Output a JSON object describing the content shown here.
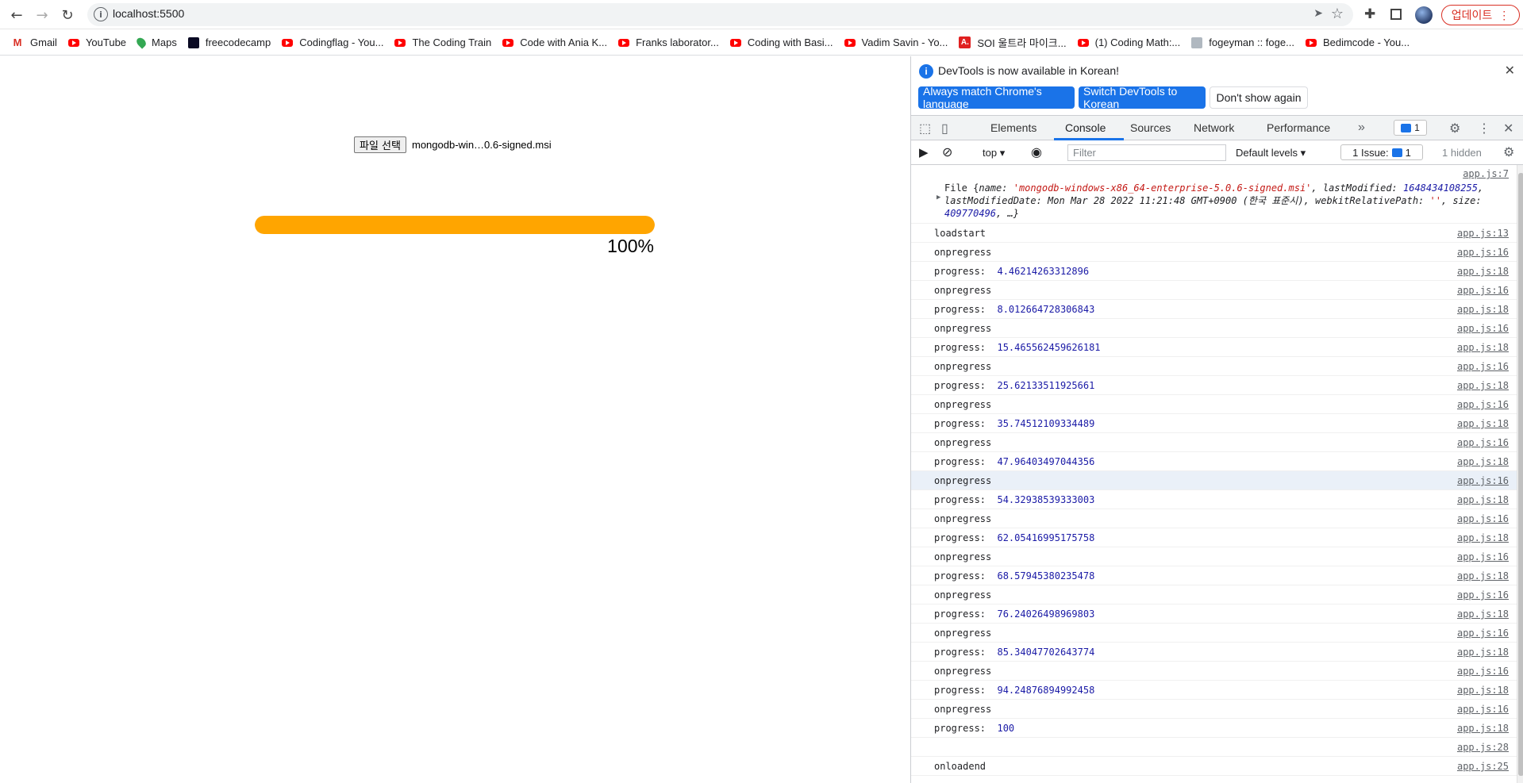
{
  "browser": {
    "url": "localhost:5500",
    "update_label": "업데이트",
    "update_menu_icon": "⋮"
  },
  "bookmarks": [
    {
      "label": "Gmail",
      "icon": "gmail"
    },
    {
      "label": "YouTube",
      "icon": "youtube"
    },
    {
      "label": "Maps",
      "icon": "maps"
    },
    {
      "label": "freecodecamp",
      "icon": "freecodecamp"
    },
    {
      "label": "Codingflag - You...",
      "icon": "youtube"
    },
    {
      "label": "The Coding Train",
      "icon": "youtube"
    },
    {
      "label": "Code with Ania K...",
      "icon": "youtube"
    },
    {
      "label": "Franks laborator...",
      "icon": "youtube"
    },
    {
      "label": "Coding with Basi...",
      "icon": "youtube"
    },
    {
      "label": "Vadim Savin - Yo...",
      "icon": "youtube"
    },
    {
      "label": "SOI 울트라 마이크...",
      "icon": "soi"
    },
    {
      "label": "(1) Coding Math:...",
      "icon": "youtube"
    },
    {
      "label": "fogeyman :: foge...",
      "icon": "fogeyman"
    },
    {
      "label": "Bedimcode - You...",
      "icon": "youtube"
    }
  ],
  "page": {
    "file_button_label": "파일 선택",
    "file_name": "mongodb-win…0.6-signed.msi",
    "progress_value": 100,
    "progress_text": "100%",
    "progress_color": "#ffa500"
  },
  "devtools": {
    "infobar": {
      "message": "DevTools is now available in Korean!",
      "btn_match": "Always match Chrome's language",
      "btn_switch": "Switch DevTools to Korean",
      "btn_dont_show": "Don't show again"
    },
    "tabs": [
      "Elements",
      "Console",
      "Sources",
      "Network",
      "Performance"
    ],
    "active_tab": "Console",
    "messages_count": "1",
    "console_bar": {
      "context": "top",
      "filter_placeholder": "Filter",
      "levels": "Default levels",
      "issues": "1 Issue:",
      "issues_count": "1",
      "hidden": "1 hidden"
    },
    "file_log": {
      "source": "app.js:7",
      "line1_prefix": "File {",
      "name_key": "name: ",
      "name_val": "'mongodb-windows-x86_64-enterprise-5.0.6-signed.msi'",
      "lastmod_key": ", lastModified: ",
      "lastmod_val": "1648434108255",
      "lastmoddate_key": ", lastModifiedDate: ",
      "lastmoddate_val": "Mon Mar 28 2022 11:21:48 GMT+0900 (한국 표준시)",
      "webkit_key": ", webkitRelativePath: ",
      "webkit_val": "''",
      "size_key": ", size: ",
      "size_val": "409770496",
      "tail": ", …}"
    },
    "logs": [
      {
        "text": "loadstart",
        "value": "",
        "source": "app.js:13"
      },
      {
        "text": "onpregress",
        "value": "",
        "source": "app.js:16"
      },
      {
        "text": "progress:  ",
        "value": "4.46214263312896",
        "source": "app.js:18"
      },
      {
        "text": "onpregress",
        "value": "",
        "source": "app.js:16"
      },
      {
        "text": "progress:  ",
        "value": "8.012664728306843",
        "source": "app.js:18"
      },
      {
        "text": "onpregress",
        "value": "",
        "source": "app.js:16"
      },
      {
        "text": "progress:  ",
        "value": "15.465562459626181",
        "source": "app.js:18"
      },
      {
        "text": "onpregress",
        "value": "",
        "source": "app.js:16"
      },
      {
        "text": "progress:  ",
        "value": "25.62133511925661",
        "source": "app.js:18"
      },
      {
        "text": "onpregress",
        "value": "",
        "source": "app.js:16"
      },
      {
        "text": "progress:  ",
        "value": "35.74512109334489",
        "source": "app.js:18"
      },
      {
        "text": "onpregress",
        "value": "",
        "source": "app.js:16"
      },
      {
        "text": "progress:  ",
        "value": "47.96403497044356",
        "source": "app.js:18"
      },
      {
        "text": "onpregress",
        "value": "",
        "source": "app.js:16",
        "highlight": true
      },
      {
        "text": "progress:  ",
        "value": "54.32938539333003",
        "source": "app.js:18"
      },
      {
        "text": "onpregress",
        "value": "",
        "source": "app.js:16"
      },
      {
        "text": "progress:  ",
        "value": "62.05416995175758",
        "source": "app.js:18"
      },
      {
        "text": "onpregress",
        "value": "",
        "source": "app.js:16"
      },
      {
        "text": "progress:  ",
        "value": "68.57945380235478",
        "source": "app.js:18"
      },
      {
        "text": "onpregress",
        "value": "",
        "source": "app.js:16"
      },
      {
        "text": "progress:  ",
        "value": "76.24026498969803",
        "source": "app.js:18"
      },
      {
        "text": "onpregress",
        "value": "",
        "source": "app.js:16"
      },
      {
        "text": "progress:  ",
        "value": "85.34047702643774",
        "source": "app.js:18"
      },
      {
        "text": "onpregress",
        "value": "",
        "source": "app.js:16"
      },
      {
        "text": "progress:  ",
        "value": "94.24876894992458",
        "source": "app.js:18"
      },
      {
        "text": "onpregress",
        "value": "",
        "source": "app.js:16"
      },
      {
        "text": "progress:  ",
        "value": "100",
        "source": "app.js:18"
      },
      {
        "text": "",
        "value": "",
        "source": "app.js:28"
      },
      {
        "text": "onloadend",
        "value": "",
        "source": "app.js:25"
      }
    ]
  }
}
